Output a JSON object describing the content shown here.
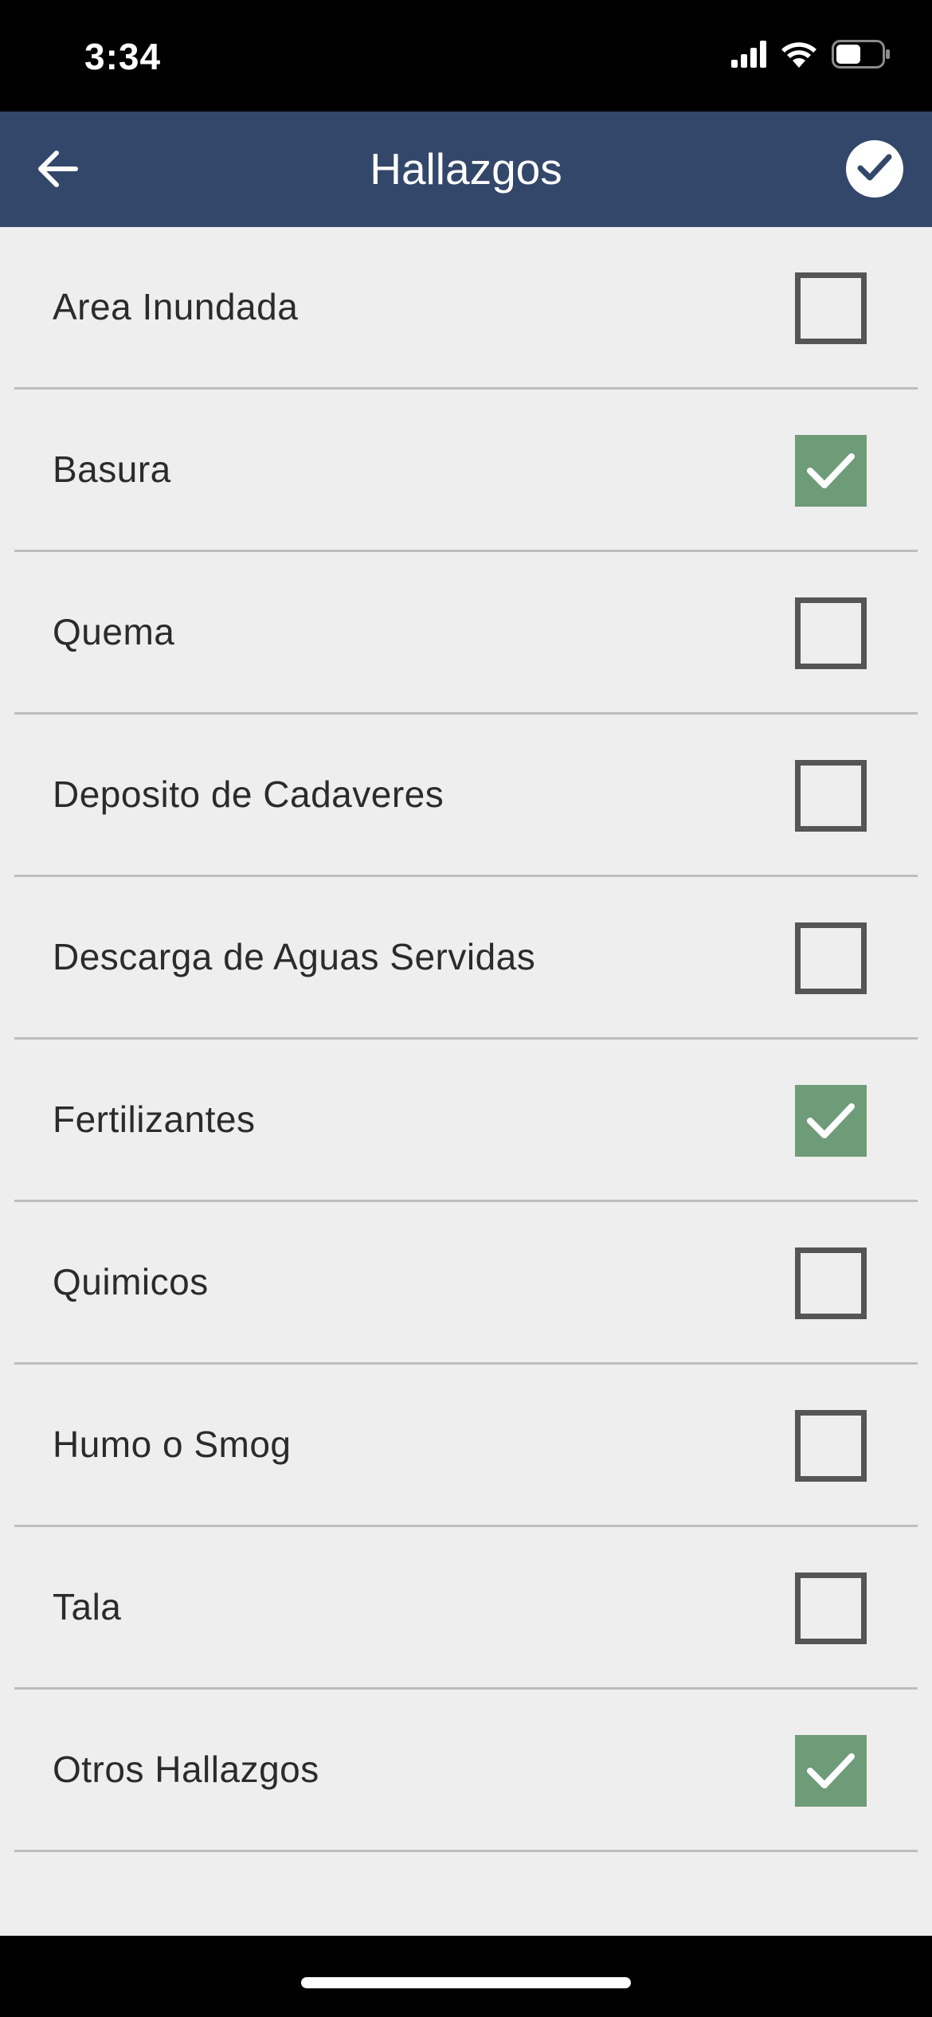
{
  "status_bar": {
    "time": "3:34",
    "icons": [
      "cellular-signal-icon",
      "wifi-icon",
      "battery-icon"
    ]
  },
  "nav": {
    "title": "Hallazgos",
    "back_icon": "arrow-left-icon",
    "confirm_icon": "check-circle-icon"
  },
  "colors": {
    "nav_background": "#33476a",
    "list_background": "#eeeeee",
    "checked_fill": "#6e9b78",
    "unchecked_border": "#555555",
    "divider": "#bdbdbd"
  },
  "items": [
    {
      "label": "Area Inundada",
      "checked": false
    },
    {
      "label": "Basura",
      "checked": true
    },
    {
      "label": "Quema",
      "checked": false
    },
    {
      "label": "Deposito de Cadaveres",
      "checked": false
    },
    {
      "label": "Descarga de Aguas Servidas",
      "checked": false
    },
    {
      "label": "Fertilizantes",
      "checked": true
    },
    {
      "label": "Quimicos",
      "checked": false
    },
    {
      "label": "Humo o Smog",
      "checked": false
    },
    {
      "label": "Tala",
      "checked": false
    },
    {
      "label": "Otros Hallazgos",
      "checked": true
    }
  ]
}
